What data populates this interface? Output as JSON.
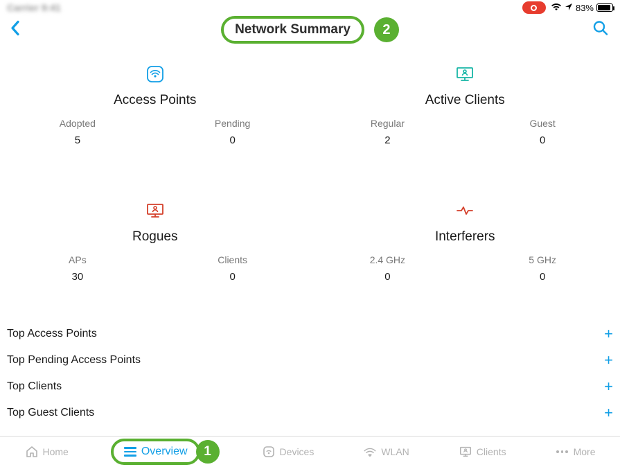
{
  "status": {
    "carrier_blur": "Carrier 9:41",
    "battery_pct": "83%"
  },
  "nav": {
    "title": "Network Summary",
    "callouts": {
      "title_num": "2",
      "overview_num": "1"
    }
  },
  "cards": {
    "access_points": {
      "title": "Access Points",
      "cols": [
        {
          "label": "Adopted",
          "value": "5"
        },
        {
          "label": "Pending",
          "value": "0"
        }
      ]
    },
    "active_clients": {
      "title": "Active Clients",
      "cols": [
        {
          "label": "Regular",
          "value": "2"
        },
        {
          "label": "Guest",
          "value": "0"
        }
      ]
    },
    "rogues": {
      "title": "Rogues",
      "cols": [
        {
          "label": "APs",
          "value": "30"
        },
        {
          "label": "Clients",
          "value": "0"
        }
      ]
    },
    "interferers": {
      "title": "Interferers",
      "cols": [
        {
          "label": "2.4 GHz",
          "value": "0"
        },
        {
          "label": "5 GHz",
          "value": "0"
        }
      ]
    }
  },
  "lists": {
    "items": [
      {
        "label": "Top Access Points"
      },
      {
        "label": "Top Pending Access Points"
      },
      {
        "label": "Top Clients"
      },
      {
        "label": "Top Guest Clients"
      }
    ]
  },
  "tabs": {
    "home": {
      "label": "Home"
    },
    "overview": {
      "label": "Overview"
    },
    "devices": {
      "label": "Devices"
    },
    "wlan": {
      "label": "WLAN"
    },
    "clients": {
      "label": "Clients"
    },
    "more": {
      "label": "More"
    }
  }
}
